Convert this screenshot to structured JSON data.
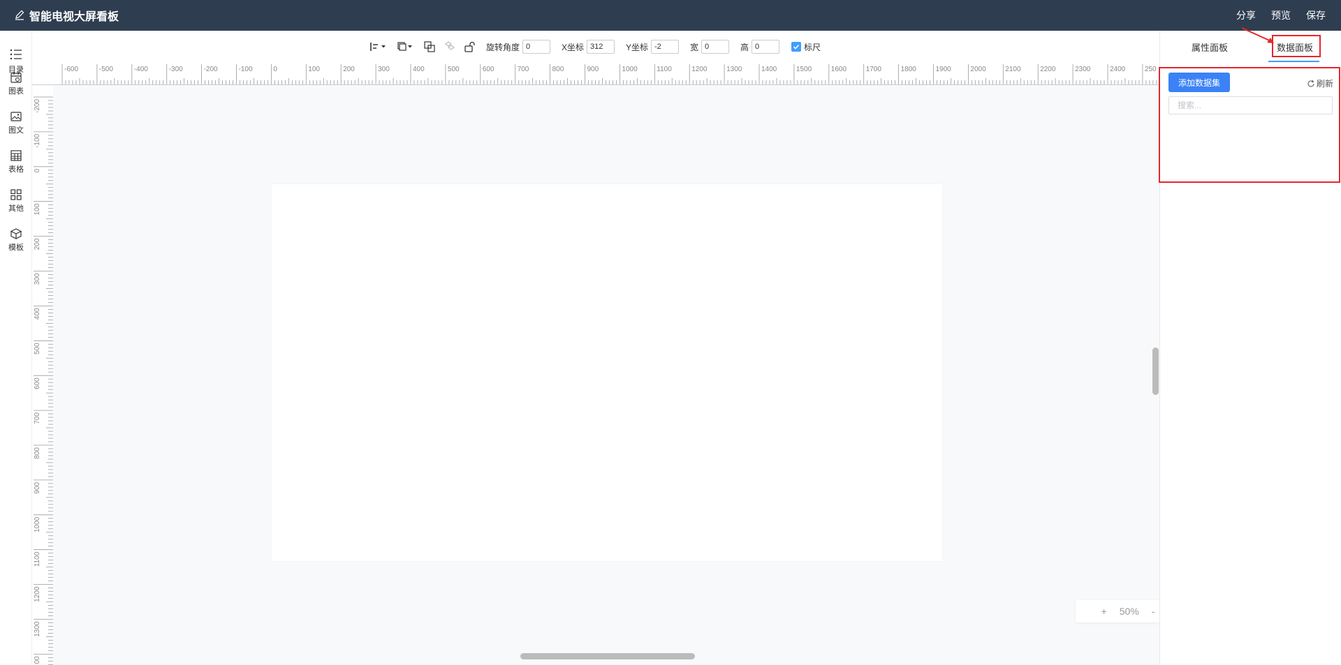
{
  "header": {
    "title": "智能电视大屏看板",
    "actions": {
      "share": "分享",
      "preview": "预览",
      "save": "保存"
    },
    "background": "#2e3e50"
  },
  "sidebar": {
    "items": [
      {
        "label": "目录",
        "icon": "list-icon"
      },
      {
        "label": "图表",
        "icon": "chart-calendar-icon"
      },
      {
        "label": "图文",
        "icon": "image-text-icon"
      },
      {
        "label": "表格",
        "icon": "table-icon"
      },
      {
        "label": "其他",
        "icon": "grid-icon"
      },
      {
        "label": "模板",
        "icon": "cube-template-icon"
      }
    ]
  },
  "toolbar": {
    "rotation": {
      "label": "旋转角度",
      "value": "0"
    },
    "x": {
      "label": "X坐标",
      "value": "312"
    },
    "y": {
      "label": "Y坐标",
      "value": "-2"
    },
    "width": {
      "label": "宽",
      "value": "0"
    },
    "height": {
      "label": "高",
      "value": "0"
    },
    "ruler": {
      "label": "标尺",
      "checked": true
    }
  },
  "ruler": {
    "horizontal_ticks": [
      "-600",
      "-500",
      "-400",
      "-300",
      "-200",
      "-100",
      "0",
      "100",
      "200",
      "300",
      "400",
      "500",
      "600",
      "700",
      "800",
      "900",
      "1000",
      "1100",
      "1200",
      "1300",
      "1400",
      "1500",
      "1600",
      "1700",
      "1800",
      "1900",
      "2000",
      "2100",
      "2200",
      "2300",
      "2400",
      "250"
    ],
    "vertical_ticks": [
      "-200",
      "-100",
      "0",
      "100",
      "200",
      "300",
      "400",
      "500",
      "600",
      "700",
      "800",
      "900",
      "1000",
      "1100",
      "1200",
      "1300",
      "00"
    ]
  },
  "zoom": {
    "plus": "+",
    "value": "50%",
    "minus": "-"
  },
  "panel": {
    "tabs": [
      "属性面板",
      "数据面板"
    ],
    "active_tab": "数据面板",
    "add_button": "添加数据集",
    "refresh": "刷新",
    "search_placeholder": "搜索...",
    "accent": "#409eff",
    "highlight": "#e6262b"
  }
}
